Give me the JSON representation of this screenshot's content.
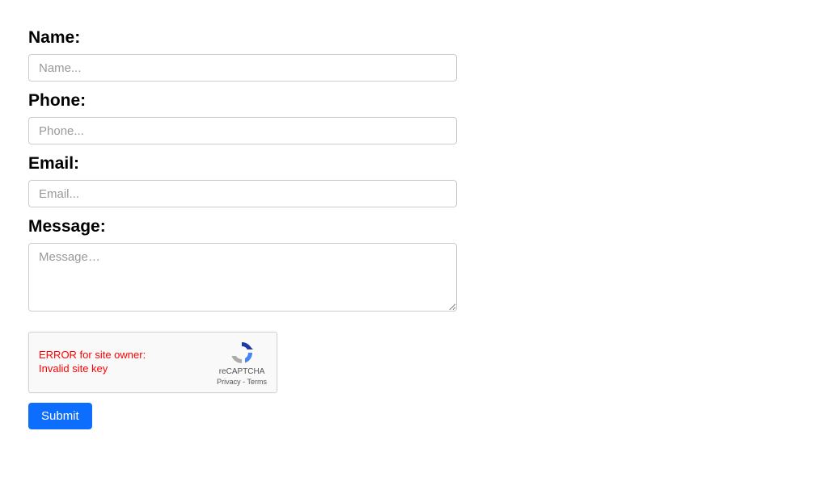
{
  "form": {
    "name": {
      "label": "Name:",
      "placeholder": "Name...",
      "value": ""
    },
    "phone": {
      "label": "Phone:",
      "placeholder": "Phone...",
      "value": ""
    },
    "email": {
      "label": "Email:",
      "placeholder": "Email...",
      "value": ""
    },
    "message": {
      "label": "Message:",
      "placeholder": "Message…",
      "value": ""
    }
  },
  "recaptcha": {
    "error": "ERROR for site owner: Invalid site key",
    "brand": "reCAPTCHA",
    "links": "Privacy - Terms"
  },
  "buttons": {
    "submit": "Submit"
  }
}
